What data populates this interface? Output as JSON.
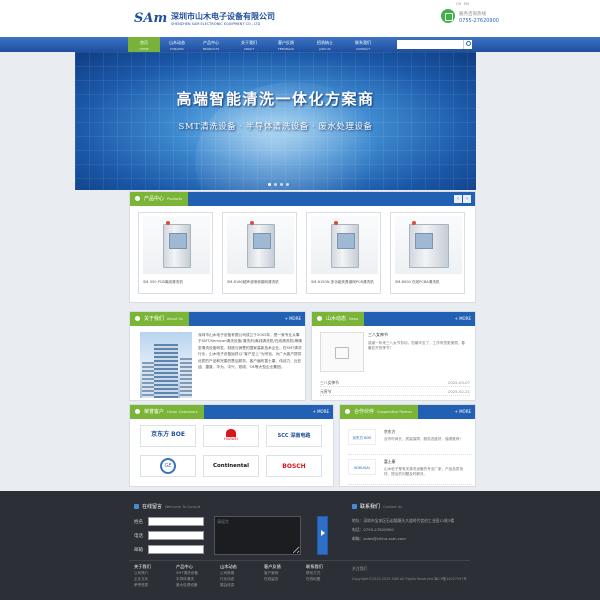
{
  "header": {
    "logo": "SAm",
    "company_name": "深圳市山木电子设备有限公司",
    "company_en": "SHENZHEN SAM ELECTRONIC EQUIPMENT CO., LTD",
    "lang_cn": "CH",
    "lang_en": "EN",
    "hotline_label": "服务咨询热线",
    "hotline_number": "0755-27620900"
  },
  "nav": {
    "items": [
      {
        "cn": "首页",
        "en": "HOME"
      },
      {
        "cn": "山木动态",
        "en": "DYNAMIC"
      },
      {
        "cn": "产品中心",
        "en": "PRODUCTS"
      },
      {
        "cn": "关于我们",
        "en": "ABOUT"
      },
      {
        "cn": "客户反馈",
        "en": "FEEDBACK"
      },
      {
        "cn": "招贤纳士",
        "en": "JOIN US"
      },
      {
        "cn": "联系我们",
        "en": "CONTACT"
      }
    ],
    "search_placeholder": ""
  },
  "banner": {
    "title": "高端智能清洗一体化方案商",
    "subtitle": "SMT清洗设备 · 半导体清洗设备 · 废水处理设备"
  },
  "products": {
    "title": "产品中心",
    "title_en": "Products",
    "prev": "‹",
    "next": "›",
    "items": [
      "SM-350 PCB离线清洗机",
      "SM-8160超声波喷淋钢网清洗机",
      "SM-8150N 多功能夹具钢网PCB清洗机",
      "SM-8000 在线PCBA清洗机"
    ]
  },
  "about": {
    "title": "关于我们",
    "title_en": "About Us",
    "more": "+ MORE",
    "text": "深圳市山木电子设备有限公司成立于2003年，是一家专业从事于SMT/Semicon清洗设备(清洗剂/离线清洗机/在线清洗机)等精密清洗设备研发、制造与销售的国家高新技术企业。在SMT清洗行业，山木电子设备始终以“客户至上”为宗旨，为广大客户提供优质的产品和完善的售后服务，客户遍布富士康、伟创力、比亚迪、捷普、华为、中兴、旭硕、OE等大型企业集团。"
  },
  "news": {
    "title": "山木动态",
    "title_en": "News",
    "more": "+ MORE",
    "featured_title": "三八女神节",
    "featured_desc": "感谢一年来三八女节劳动，您最辛苦了，工作有您更美丽，春暖花开的季节！",
    "list": [
      {
        "title": "三八女神节",
        "date": "2025-03-07"
      },
      {
        "title": "元宵节",
        "date": "2025-02-21"
      }
    ]
  },
  "customers": {
    "title": "荣誉客户",
    "title_en": "Honor Customers",
    "more": "+ MORE",
    "logos": [
      "京东方 BOE",
      "HUAWEI",
      "SCC 深南电路",
      "GE",
      "Continental",
      "BOSCH"
    ]
  },
  "partners": {
    "title": "合作伙伴",
    "title_en": "Cooperative Partner",
    "more": "+ MORE",
    "items": [
      {
        "logo": "京东方 BOE",
        "name": "京东方",
        "desc": "合作时间长，质量保障，服务态度好，值得推荐！"
      },
      {
        "logo": "KOKUSAI",
        "name": "富士康",
        "desc": "山木电子是有关清洗设备的专业厂家，产品品质良好，提出的问题及时解决。"
      }
    ]
  },
  "footer": {
    "message_title": "在线留言",
    "message_en": "Welcome To Consult",
    "name_label": "姓名",
    "phone_label": "电话",
    "email_label": "邮箱",
    "message_placeholder": "请留言",
    "contact_title": "联系我们",
    "contact_en": "Contact Us",
    "address": "地址：深圳市宝安区石岩镇塘头大道时代信创工业园11栋3楼",
    "phone": "电话：0755-27620900",
    "email": "邮箱：sales@china-sam.com",
    "columns": [
      {
        "head": "关于我们",
        "items": [
          "公司简介",
          "企业文化",
          "荣誉资质"
        ]
      },
      {
        "head": "产品中心",
        "items": [
          "SMT清洗设备",
          "半导体清洗",
          "废水处理设备"
        ]
      },
      {
        "head": "山木动态",
        "items": [
          "公司新闻",
          "行业动态",
          "展会信息"
        ]
      },
      {
        "head": "客户反馈",
        "items": [
          "客户案例",
          "在线留言"
        ]
      },
      {
        "head": "联系我们",
        "items": [
          "联系方式",
          "在线地图"
        ]
      }
    ],
    "wechat": "关注我们",
    "copyright": "Copyright©2015-2025 SAM All Rights Reserved  粤ICP备14027597号"
  },
  "colors": {
    "nav_blue": "#2160b3",
    "accent_green": "#7ab538",
    "footer_bg": "#2c2f35"
  }
}
